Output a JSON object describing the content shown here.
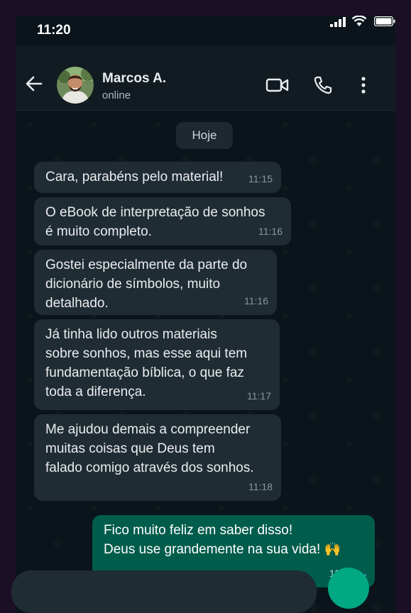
{
  "status_bar": {
    "time": "11:20"
  },
  "header": {
    "contact_name": "Marcos A.",
    "contact_status": "online"
  },
  "chat": {
    "date_label": "Hoje",
    "messages": [
      {
        "direction": "in",
        "lines": [
          "Cara, parabéns pelo material!"
        ],
        "time": "11:15"
      },
      {
        "direction": "in",
        "lines": [
          "O eBook de interpretação de sonhos",
          "é muito completo."
        ],
        "time": "11:16"
      },
      {
        "direction": "in",
        "lines": [
          "Gostei especialmente da parte do",
          "dicionário de símbolos, muito",
          "detalhado."
        ],
        "time": "11:16"
      },
      {
        "direction": "in",
        "lines": [
          "Já tinha lido outros materiais",
          "sobre sonhos, mas esse aqui tem",
          "fundamentação bíblica, o que faz",
          "toda a diferença."
        ],
        "time": "11:17"
      },
      {
        "direction": "in",
        "lines": [
          "Me ajudou demais a compreender",
          "muitas coisas que Deus tem",
          "falado comigo através dos sonhos."
        ],
        "time": "11:18"
      },
      {
        "direction": "out",
        "lines": [
          "Fico muito feliz em saber disso!",
          "Deus use grandemente na sua vida! 🙌"
        ],
        "time": "11:20",
        "status": "read"
      }
    ]
  },
  "colors": {
    "incoming_bubble": "#202c33",
    "outgoing_bubble": "#005c4b",
    "read_ticks": "#53bdeb",
    "accent": "#00a884"
  },
  "icons": {
    "back": "arrow-left-icon",
    "video": "video-camera-icon",
    "call": "phone-icon",
    "menu": "more-vertical-icon",
    "read": "double-check-icon"
  }
}
